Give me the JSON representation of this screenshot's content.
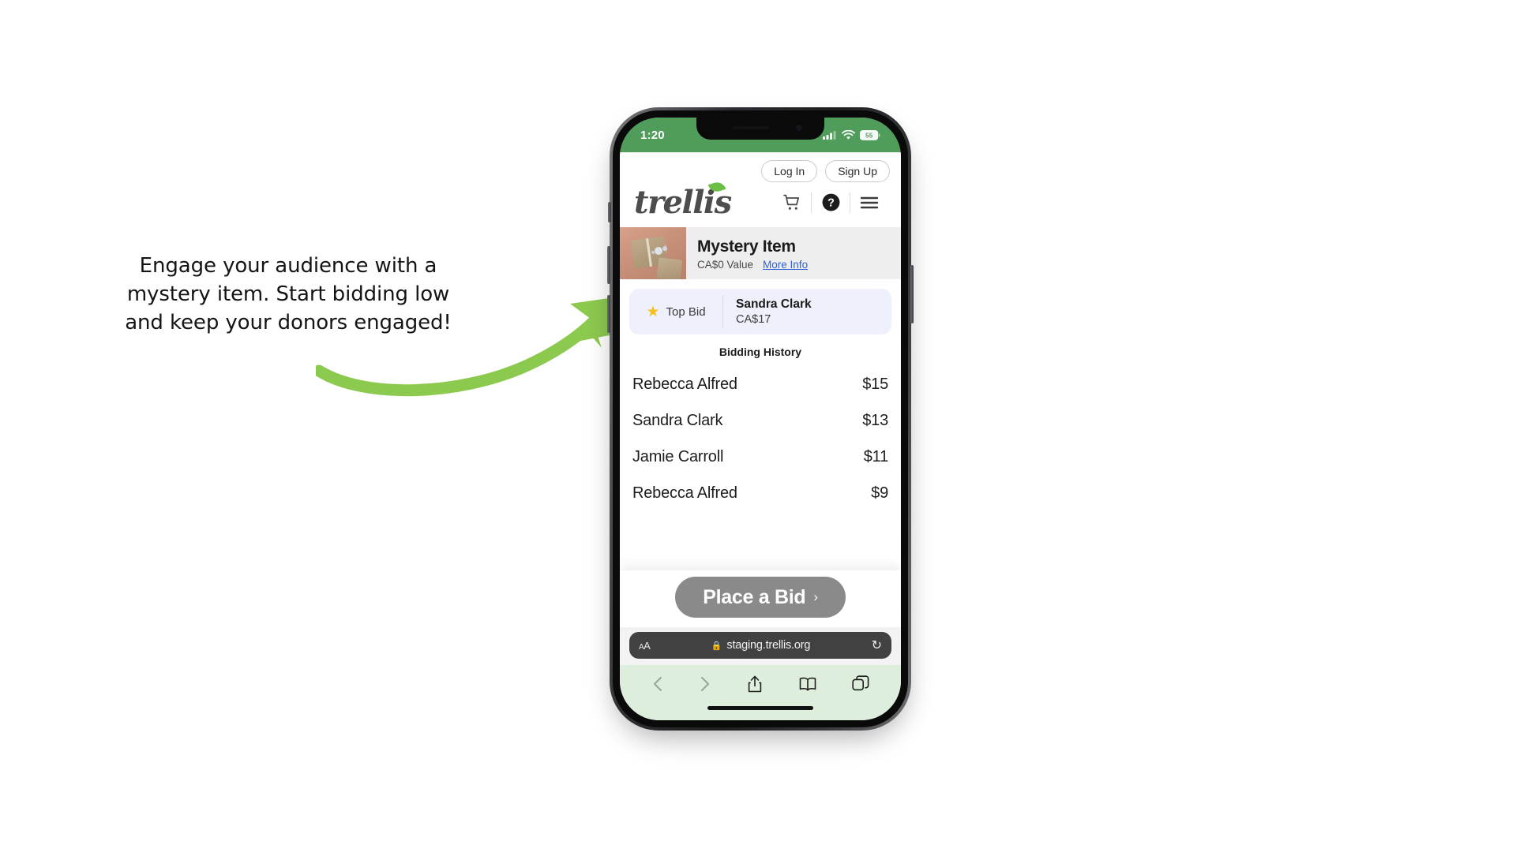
{
  "annotation": {
    "lines": [
      "Engage your audience with a",
      "mystery item. Start bidding low",
      "and keep your donors engaged!"
    ],
    "arrow_color": "#8cc94f"
  },
  "phone": {
    "status_bar": {
      "time": "1:20",
      "background_color": "#4f9c5b",
      "battery_level": "55",
      "signal_icon": "cellular-signal-icon",
      "wifi_icon": "wifi-icon",
      "battery_icon": "battery-icon"
    },
    "home_indicator": "home-indicator"
  },
  "site": {
    "header": {
      "log_in_label": "Log In",
      "sign_up_label": "Sign Up",
      "logo_text": "trellis",
      "logo_leaf_color": "#6cbf45",
      "icons": [
        {
          "name": "cart-icon",
          "glyph": "cart"
        },
        {
          "name": "help-icon",
          "glyph": "question"
        },
        {
          "name": "menu-icon",
          "glyph": "hamburger"
        }
      ]
    },
    "item": {
      "title": "Mystery Item",
      "value_label": "CA$0 Value",
      "more_info_label": "More Info",
      "thumbnail_alt": "wrapped-gift-photo"
    },
    "top_bid": {
      "badge_label": "Top Bid",
      "star_icon": "star-icon",
      "bidder_name": "Sandra Clark",
      "amount": "CA$17",
      "card_color": "#eef1fb"
    },
    "bidding_history": {
      "title": "Bidding History",
      "rows": [
        {
          "name": "Rebecca Alfred",
          "amount": "$15"
        },
        {
          "name": "Sandra Clark",
          "amount": "$13"
        },
        {
          "name": "Jamie Carroll",
          "amount": "$11"
        },
        {
          "name": "Rebecca Alfred",
          "amount": "$9"
        }
      ]
    },
    "cta": {
      "label": "Place a Bid",
      "chevron": "›",
      "color": "#8a8a8a"
    }
  },
  "browser": {
    "text_size_label": "AA",
    "lock_icon": "lock-icon",
    "url": "staging.trellis.org",
    "reload_icon": "reload-icon",
    "toolbar": [
      {
        "name": "back-button",
        "glyph": "chevron-left"
      },
      {
        "name": "forward-button",
        "glyph": "chevron-right"
      },
      {
        "name": "share-button",
        "glyph": "share"
      },
      {
        "name": "bookmarks-button",
        "glyph": "book"
      },
      {
        "name": "tabs-button",
        "glyph": "tabs"
      }
    ]
  }
}
